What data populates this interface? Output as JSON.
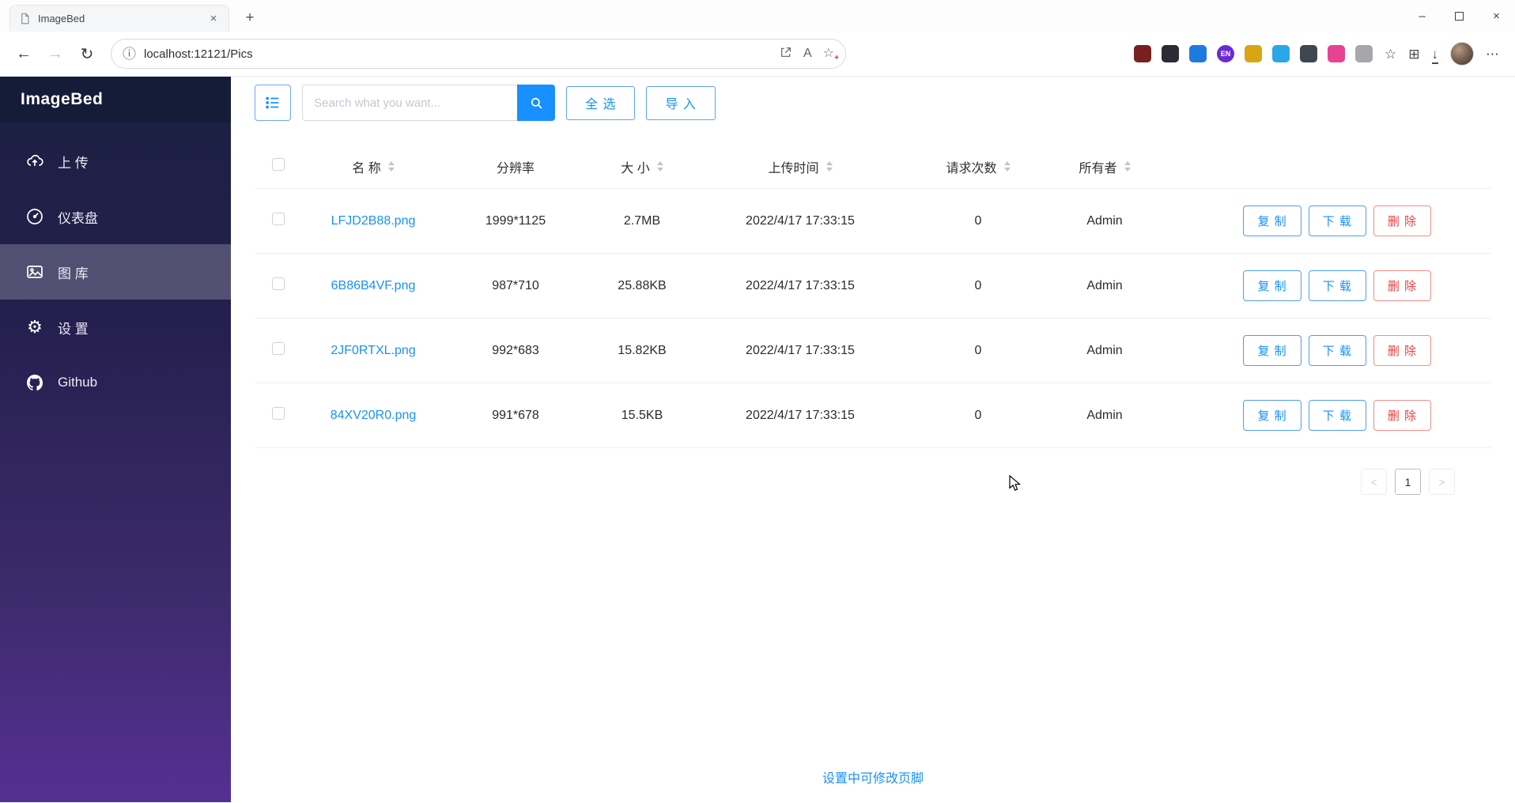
{
  "browser": {
    "tab_title": "ImageBed",
    "close_tab": "×",
    "new_tab": "+",
    "minimize": "–",
    "close_window": "×",
    "back": "←",
    "forward": "→",
    "refresh": "↻",
    "info": "ⓘ",
    "url": "localhost:12121/Pics",
    "read_aloud": "A",
    "add_favorite": "☆",
    "add_favorite_plus": "+",
    "ext_icons": [
      {
        "name": "ublock-ext-icon",
        "color": "#7a1f1f",
        "label": ""
      },
      {
        "name": "dark-ext-icon",
        "color": "#2b2b33",
        "label": ""
      },
      {
        "name": "blue-round-ext-icon",
        "color": "#1f7ae0",
        "label": ""
      },
      {
        "name": "translate-ext-icon",
        "color": "#6d28d9",
        "label": "EN"
      },
      {
        "name": "notes-ext-icon",
        "color": "#d9a514",
        "label": ""
      },
      {
        "name": "capture-ext-icon",
        "color": "#2aa7e8",
        "label": ""
      },
      {
        "name": "blocker-ext-icon",
        "color": "#3f4650",
        "label": ""
      },
      {
        "name": "colorful-ext-icon",
        "color": "#e84393",
        "label": ""
      },
      {
        "name": "puzzle-ext-icon",
        "color": "#a6a6ad",
        "label": ""
      }
    ],
    "favorites": "☆",
    "collections": "⊞",
    "downloads": "↓",
    "more": "⋯"
  },
  "sidebar": {
    "brand": "ImageBed",
    "items": [
      {
        "label": "上 传"
      },
      {
        "label": "仪表盘"
      },
      {
        "label": "图 库"
      },
      {
        "label": "设 置"
      },
      {
        "label": "Github"
      }
    ]
  },
  "toolbar": {
    "search_placeholder": "Search what you want...",
    "select_all": "全 选",
    "import": "导 入"
  },
  "table": {
    "headers": [
      {
        "label": "名 称"
      },
      {
        "label": "分辨率"
      },
      {
        "label": "大 小"
      },
      {
        "label": "上传时间"
      },
      {
        "label": "请求次数"
      },
      {
        "label": "所有者"
      }
    ],
    "rows": [
      {
        "name": "LFJD2B88.png",
        "resolution": "1999*1125",
        "size": "2.7MB",
        "time": "2022/4/17 17:33:15",
        "requests": "0",
        "owner": "Admin"
      },
      {
        "name": "6B86B4VF.png",
        "resolution": "987*710",
        "size": "25.88KB",
        "time": "2022/4/17 17:33:15",
        "requests": "0",
        "owner": "Admin"
      },
      {
        "name": "2JF0RTXL.png",
        "resolution": "992*683",
        "size": "15.82KB",
        "time": "2022/4/17 17:33:15",
        "requests": "0",
        "owner": "Admin"
      },
      {
        "name": "84XV20R0.png",
        "resolution": "991*678",
        "size": "15.5KB",
        "time": "2022/4/17 17:33:15",
        "requests": "0",
        "owner": "Admin"
      }
    ],
    "actions": {
      "copy": "复 制",
      "download": "下 载",
      "delete": "删 除"
    }
  },
  "pagination": {
    "prev": "<",
    "page": "1",
    "next": ">"
  },
  "footer": {
    "note": "设置中可修改页脚"
  },
  "colors": {
    "accent": "#1890ff",
    "danger": "#ff4d4f"
  }
}
